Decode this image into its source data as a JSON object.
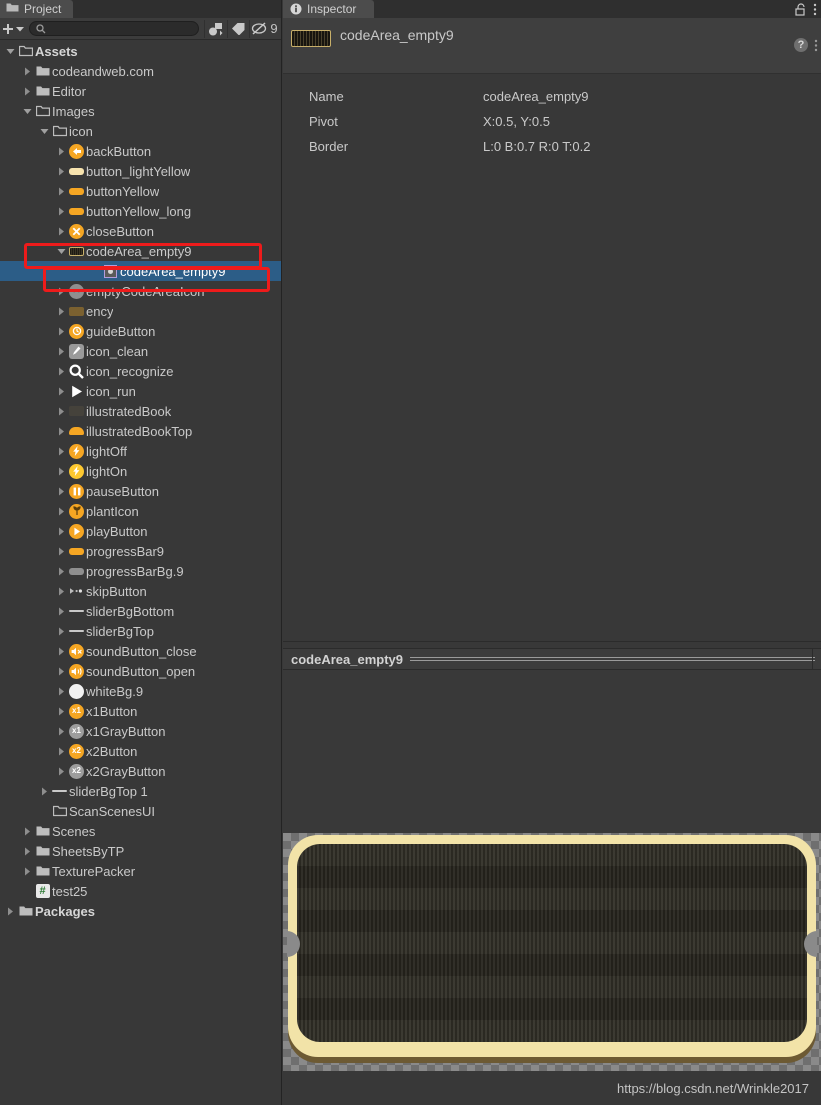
{
  "project": {
    "tab_label": "Project",
    "tab_icon": "folder-icon",
    "toolbar": {
      "add_label": "+",
      "add_dropdown_icon": "chevron-down-icon",
      "search_placeholder": "",
      "search_value": "",
      "search_icon": "search-icon",
      "filter_by_type_icon": "filter-by-type-icon",
      "filter_by_label_icon": "label-tag-icon",
      "hidden_toggle_icon": "eye-off-icon",
      "hidden_count": "9"
    },
    "tree": [
      {
        "label": "Assets",
        "depth": 0,
        "arrow": "down",
        "icon": "folder-open-icon",
        "bold": true
      },
      {
        "label": "codeandweb.com",
        "depth": 1,
        "arrow": "right",
        "icon": "folder-icon"
      },
      {
        "label": "Editor",
        "depth": 1,
        "arrow": "right",
        "icon": "folder-icon"
      },
      {
        "label": "Images",
        "depth": 1,
        "arrow": "down",
        "icon": "folder-open-icon"
      },
      {
        "label": "icon",
        "depth": 2,
        "arrow": "down",
        "icon": "folder-open-icon"
      },
      {
        "label": "backButton",
        "depth": 3,
        "arrow": "right",
        "icon": "sprite-circle-orange-back-icon"
      },
      {
        "label": "button_lightYellow",
        "depth": 3,
        "arrow": "right",
        "icon": "sprite-pill-lightyellow-icon"
      },
      {
        "label": "buttonYellow",
        "depth": 3,
        "arrow": "right",
        "icon": "sprite-pill-yellow-icon"
      },
      {
        "label": "buttonYellow_long",
        "depth": 3,
        "arrow": "right",
        "icon": "sprite-pill-yellow-long-icon"
      },
      {
        "label": "closeButton",
        "depth": 3,
        "arrow": "right",
        "icon": "sprite-circle-orange-close-icon"
      },
      {
        "label": "codeArea_empty9",
        "depth": 3,
        "arrow": "down",
        "icon": "sprite-striped-icon"
      },
      {
        "label": "codeArea_empty9",
        "depth": 5,
        "arrow": "none",
        "icon": "sub-sprite-icon",
        "selected": true
      },
      {
        "label": "emptyCodeAreaIcon",
        "depth": 3,
        "arrow": "right",
        "icon": "sprite-circle-gray-icon"
      },
      {
        "label": "ency",
        "depth": 3,
        "arrow": "right",
        "icon": "sprite-rect-brown-icon"
      },
      {
        "label": "guideButton",
        "depth": 3,
        "arrow": "right",
        "icon": "sprite-circle-orange-guide-icon"
      },
      {
        "label": "icon_clean",
        "depth": 3,
        "arrow": "right",
        "icon": "sprite-gray-brush-icon"
      },
      {
        "label": "icon_recognize",
        "depth": 3,
        "arrow": "right",
        "icon": "sprite-magnifier-icon"
      },
      {
        "label": "icon_run",
        "depth": 3,
        "arrow": "right",
        "icon": "sprite-triangle-white-icon"
      },
      {
        "label": "illustratedBook",
        "depth": 3,
        "arrow": "right",
        "icon": "sprite-dark-faint-icon"
      },
      {
        "label": "illustratedBookTop",
        "depth": 3,
        "arrow": "right",
        "icon": "sprite-arc-orange-icon"
      },
      {
        "label": "lightOff",
        "depth": 3,
        "arrow": "right",
        "icon": "sprite-circle-orange-bulb-icon"
      },
      {
        "label": "lightOn",
        "depth": 3,
        "arrow": "right",
        "icon": "sprite-circle-yellow-bulb-icon"
      },
      {
        "label": "pauseButton",
        "depth": 3,
        "arrow": "right",
        "icon": "sprite-circle-orange-pause-icon"
      },
      {
        "label": "plantIcon",
        "depth": 3,
        "arrow": "right",
        "icon": "sprite-circle-orange-plant-icon"
      },
      {
        "label": "playButton",
        "depth": 3,
        "arrow": "right",
        "icon": "sprite-circle-orange-play-icon"
      },
      {
        "label": "progressBar9",
        "depth": 3,
        "arrow": "right",
        "icon": "sprite-pill-orange-icon"
      },
      {
        "label": "progressBarBg.9",
        "depth": 3,
        "arrow": "right",
        "icon": "sprite-pill-gray-icon"
      },
      {
        "label": "skipButton",
        "depth": 3,
        "arrow": "right",
        "icon": "sprite-skip-icon"
      },
      {
        "label": "sliderBgBottom",
        "depth": 3,
        "arrow": "right",
        "icon": "sprite-line-icon"
      },
      {
        "label": "sliderBgTop",
        "depth": 3,
        "arrow": "right",
        "icon": "sprite-line-icon"
      },
      {
        "label": "soundButton_close",
        "depth": 3,
        "arrow": "right",
        "icon": "sprite-circle-orange-mute-icon"
      },
      {
        "label": "soundButton_open",
        "depth": 3,
        "arrow": "right",
        "icon": "sprite-circle-orange-sound-icon"
      },
      {
        "label": "whiteBg.9",
        "depth": 3,
        "arrow": "right",
        "icon": "sprite-circle-white-icon"
      },
      {
        "label": "x1Button",
        "depth": 3,
        "arrow": "right",
        "icon": "sprite-circle-orange-x1-icon"
      },
      {
        "label": "x1GrayButton",
        "depth": 3,
        "arrow": "right",
        "icon": "sprite-circle-gray-x1-icon"
      },
      {
        "label": "x2Button",
        "depth": 3,
        "arrow": "right",
        "icon": "sprite-circle-orange-x2-icon"
      },
      {
        "label": "x2GrayButton",
        "depth": 3,
        "arrow": "right",
        "icon": "sprite-circle-gray-x2-icon"
      },
      {
        "label": "sliderBgTop 1",
        "depth": 2,
        "arrow": "right",
        "icon": "sprite-line-icon"
      },
      {
        "label": "ScanScenesUI",
        "depth": 2,
        "arrow": "none",
        "icon": "folder-open-icon"
      },
      {
        "label": "Scenes",
        "depth": 1,
        "arrow": "right",
        "icon": "folder-icon"
      },
      {
        "label": "SheetsByTP",
        "depth": 1,
        "arrow": "right",
        "icon": "folder-icon"
      },
      {
        "label": "TexturePacker",
        "depth": 1,
        "arrow": "right",
        "icon": "folder-icon"
      },
      {
        "label": "test25",
        "depth": 1,
        "arrow": "none",
        "icon": "csharp-script-icon"
      },
      {
        "label": "Packages",
        "depth": 0,
        "arrow": "right",
        "icon": "folder-icon",
        "bold": true
      }
    ]
  },
  "inspector": {
    "tab_label": "Inspector",
    "tab_icon": "info-icon",
    "lock_icon": "lock-open-icon",
    "menu_icon": "kebab-menu-icon",
    "asset_name": "codeArea_empty9",
    "thumb_icon": "sprite-striped-icon",
    "help_icon": "help-icon",
    "settings_icon": "kebab-menu-icon",
    "properties": [
      {
        "name": "Name",
        "value": "codeArea_empty9"
      },
      {
        "name": "Pivot",
        "value": "X:0.5, Y:0.5"
      },
      {
        "name": "Border",
        "value": "L:0 B:0.7 R:0 T:0.2"
      }
    ],
    "preview": {
      "title": "codeArea_empty9",
      "sprite_frame_color": "#f2e3a8",
      "sprite_fill_color": "#2c2a22"
    }
  },
  "annotations": {
    "highlight_color": "#ee1b1b",
    "boxes": [
      {
        "target": "codeArea_empty9-parent-row"
      },
      {
        "target": "codeArea_empty9-sub-sprite-row"
      }
    ]
  },
  "footer": {
    "url": "https://blog.csdn.net/Wrinkle2017"
  }
}
